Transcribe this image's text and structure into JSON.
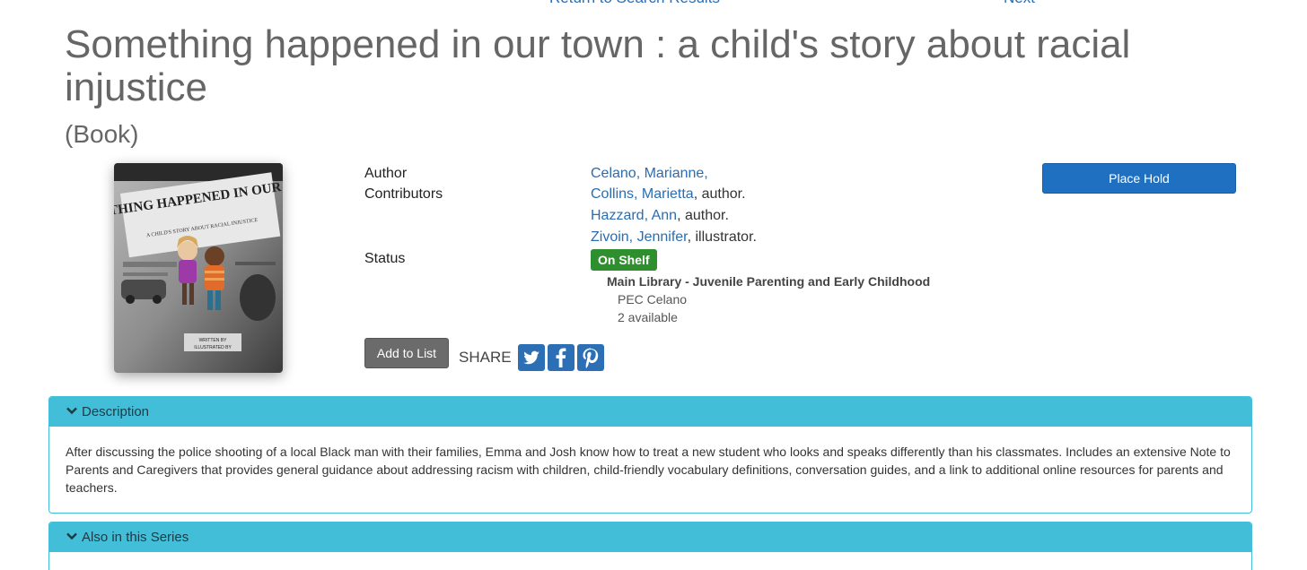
{
  "nav": {
    "back_label": "Return to Search Results",
    "next_label": "Next"
  },
  "record": {
    "title": "Something happened in our town : a child's story about racial injustice",
    "format": "(Book)"
  },
  "cover": {
    "headline": "SOMETHING HAPPENED IN OUR TOWN",
    "subtitle": "A CHILD'S STORY ABOUT RACIAL INJUSTICE",
    "byline1": "WRITTEN BY",
    "byline2": "ILLUSTRATED BY"
  },
  "details": {
    "author_label": "Author",
    "contributors_label": "Contributors",
    "status_label": "Status",
    "author": {
      "name": "Celano, Marianne,"
    },
    "contributors": [
      {
        "name": "Collins, Marietta",
        "role": ", author."
      },
      {
        "name": "Hazzard, Ann",
        "role": ", author."
      },
      {
        "name": "Zivoin, Jennifer",
        "role": ", illustrator."
      }
    ],
    "status": "On Shelf",
    "location": "Main Library - Juvenile Parenting and Early Childhood",
    "call_number": "PEC Celano",
    "availability": "2 available"
  },
  "actions": {
    "place_hold": "Place Hold",
    "add_to_list": "Add to List",
    "share_label": "SHARE",
    "share_icons": [
      "twitter-icon",
      "facebook-icon",
      "pinterest-icon"
    ]
  },
  "panels": {
    "description": {
      "heading": "Description",
      "text": "After discussing the police shooting of a local Black man with their families, Emma and Josh know how to treat a new student who looks and speaks differently than his classmates. Includes an extensive Note to Parents and Caregivers that provides general guidance about addressing racism with children, child-friendly vocabulary definitions, conversation guides, and a link to additional online resources for parents and teachers."
    },
    "series": {
      "heading": "Also in this Series"
    }
  },
  "colors": {
    "link": "#2a6db0",
    "primary_button": "#1f70c1",
    "status_badge": "#2f8f2f",
    "panel_header": "#42bed8"
  }
}
